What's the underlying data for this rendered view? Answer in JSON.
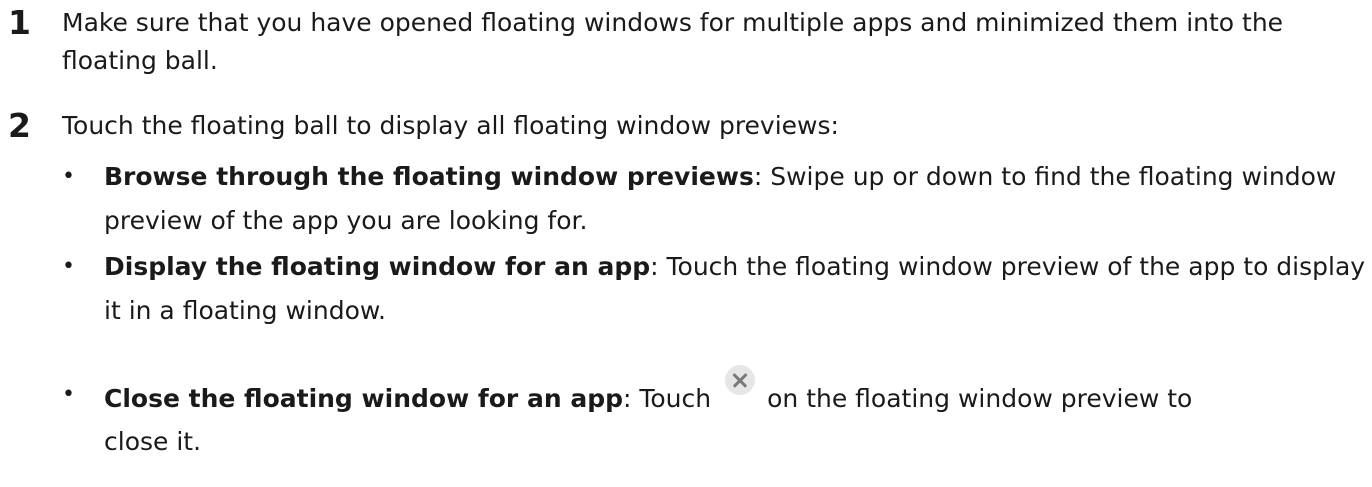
{
  "steps": [
    {
      "number": "1",
      "text": "Make sure that you have opened floating windows for multiple apps and minimized them into the floating ball."
    },
    {
      "number": "2",
      "text": "Touch the floating ball to display all floating window previews:"
    }
  ],
  "bullets": [
    {
      "marker": "•",
      "label": "Browse through the floating window previews",
      "separator": ":",
      "text": " Swipe up or down to find the floating window preview of the app you are looking for."
    },
    {
      "marker": "•",
      "label": "Display the floating window for an app",
      "separator": ":",
      "text": " Touch the floating window preview of the app to display it in a floating window."
    },
    {
      "marker": "•",
      "label": "Close the floating window for an app",
      "separator": ":",
      "text_before_icon": " Touch",
      "icon": "close-icon",
      "text_after_icon": "on the floating window preview to",
      "text_line2": "close it."
    }
  ]
}
